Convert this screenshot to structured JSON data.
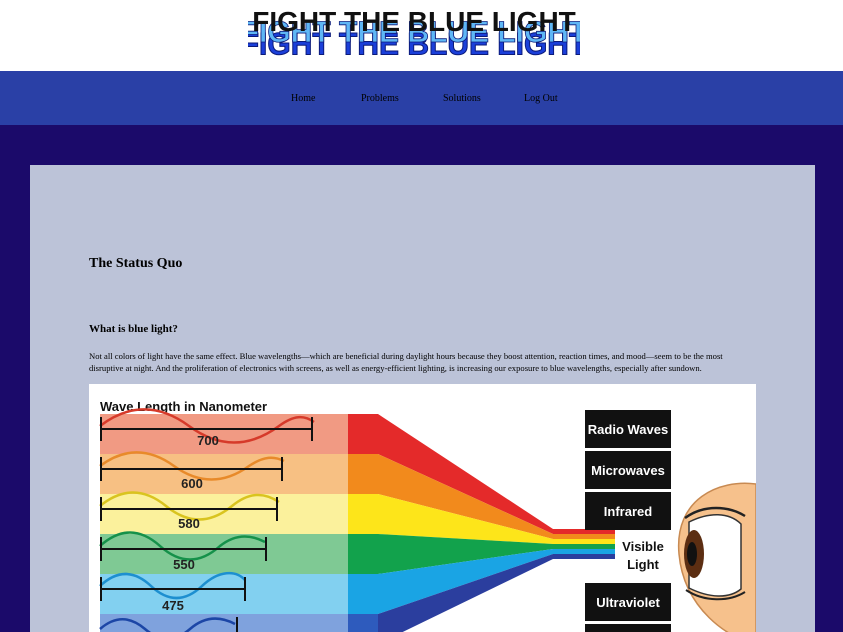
{
  "site": {
    "logo_text": "FIGHT THE BLUE LIGHT"
  },
  "nav": {
    "items": [
      {
        "label": "Home"
      },
      {
        "label": "Problems"
      },
      {
        "label": "Solutions"
      },
      {
        "label": "Log Out"
      }
    ]
  },
  "main": {
    "title": "The Status Quo",
    "section_heading": "What is blue light?",
    "paragraph": "Not all colors of light have the same effect. Blue wavelengths—which are beneficial during daylight hours because they boost attention, reaction times, and mood—seem to be the most disruptive at night. And the proliferation of electronics with screens, as well as energy-efficient lighting, is increasing our exposure to blue wavelengths, especially after sundown."
  },
  "figure": {
    "title": "Wave Length in Nanometer",
    "wavelengths": [
      {
        "value": "700",
        "color": "#e8402a"
      },
      {
        "value": "600",
        "color": "#f2962a"
      },
      {
        "value": "580",
        "color": "#f5e62b"
      },
      {
        "value": "550",
        "color": "#1ea24e"
      },
      {
        "value": "475",
        "color": "#27a6e0"
      },
      {
        "value": "",
        "color": "#2a55b8"
      }
    ],
    "spectrum_labels": {
      "radio": "Radio Waves",
      "micro": "Microwaves",
      "infrared": "Infrared",
      "visible_1": "Visible",
      "visible_2": "Light",
      "uv": "Ultraviolet"
    },
    "eye_icon": "eye-icon"
  }
}
